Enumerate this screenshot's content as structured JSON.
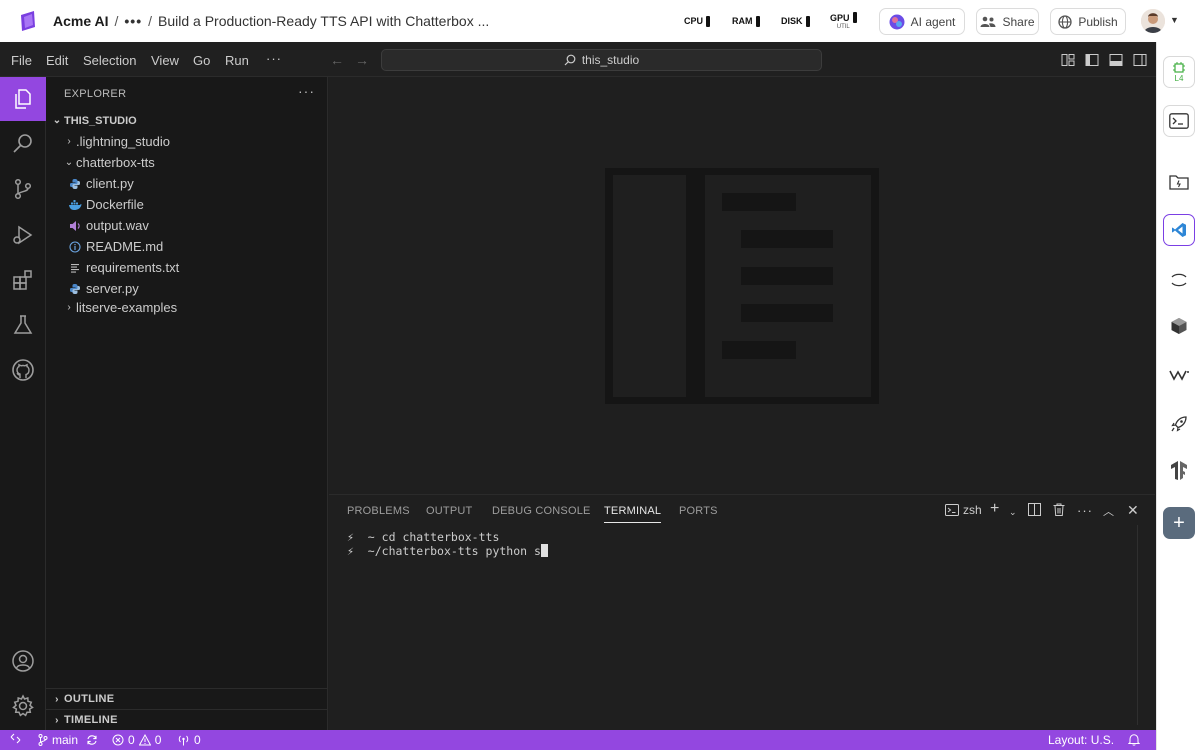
{
  "app": {
    "org_name": "Acme AI",
    "breadcrumb_more": "•••",
    "studio_title": "Build a Production-Ready TTS API with Chatterbox ..."
  },
  "metrics": [
    {
      "label": "CPU",
      "sub": ""
    },
    {
      "label": "RAM",
      "sub": ""
    },
    {
      "label": "DISK",
      "sub": ""
    },
    {
      "label": "GPU",
      "sub": "UTIL"
    }
  ],
  "topbar": {
    "ai_agent_label": "AI agent",
    "share_label": "Share",
    "publish_label": "Publish"
  },
  "menubar": {
    "items": [
      "File",
      "Edit",
      "Selection",
      "View",
      "Go",
      "Run"
    ],
    "more": "···"
  },
  "command_center": {
    "text": "this_studio"
  },
  "explorer": {
    "title": "EXPLORER",
    "more": "···",
    "root": "THIS_STUDIO",
    "tree": [
      {
        "label": ".lightning_studio",
        "type": "folder",
        "expanded": false
      },
      {
        "label": "chatterbox-tts",
        "type": "folder",
        "expanded": true
      },
      {
        "label": "client.py",
        "type": "python"
      },
      {
        "label": "Dockerfile",
        "type": "docker"
      },
      {
        "label": "output.wav",
        "type": "audio"
      },
      {
        "label": "README.md",
        "type": "info"
      },
      {
        "label": "requirements.txt",
        "type": "text"
      },
      {
        "label": "server.py",
        "type": "python"
      },
      {
        "label": "litserve-examples",
        "type": "folder",
        "expanded": false
      }
    ],
    "outline": "OUTLINE",
    "timeline": "TIMELINE"
  },
  "panel": {
    "tabs": [
      "PROBLEMS",
      "OUTPUT",
      "DEBUG CONSOLE",
      "TERMINAL",
      "PORTS"
    ],
    "active_tab": "TERMINAL",
    "shell": "zsh",
    "terminal_lines": [
      {
        "prompt": "⚡",
        "path": "~",
        "command": "cd chatterbox-tts"
      },
      {
        "prompt": "⚡",
        "path": "~/chatterbox-tts",
        "command": "python s"
      }
    ]
  },
  "rail": {
    "gpu_label": "L4"
  },
  "statusbar": {
    "branch": "main",
    "errors": "0",
    "warnings": "0",
    "ports": "0",
    "layout": "Layout: U.S."
  },
  "colors": {
    "accent": "#9347e0",
    "editor_bg": "#1f1f1f",
    "sidebar_bg": "#181818"
  }
}
